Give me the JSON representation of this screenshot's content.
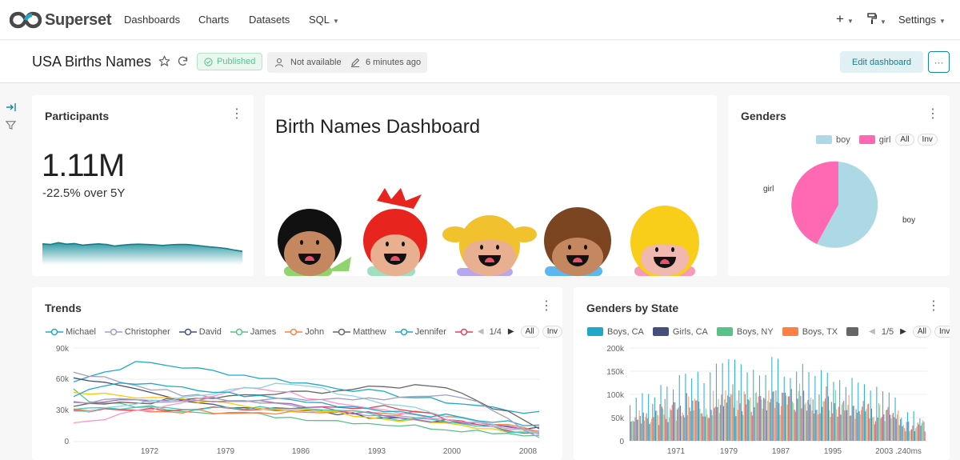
{
  "nav": {
    "brand": "Superset",
    "items": [
      "Dashboards",
      "Charts",
      "Datasets",
      "SQL"
    ],
    "settings": "Settings"
  },
  "header": {
    "title": "USA Births Names",
    "status": "Published",
    "owner": "Not available",
    "modified": "6 minutes ago",
    "edit_label": "Edit dashboard",
    "more_label": "···"
  },
  "participants": {
    "title": "Participants",
    "value": "1.11M",
    "subtitle": "-22.5% over 5Y",
    "sparkline": [
      0.62,
      0.6,
      0.66,
      0.61,
      0.63,
      0.58,
      0.6,
      0.62,
      0.6,
      0.55,
      0.58,
      0.6,
      0.61,
      0.6,
      0.59,
      0.57,
      0.59,
      0.6,
      0.6,
      0.58,
      0.55,
      0.52,
      0.5,
      0.47,
      0.42,
      0.38
    ]
  },
  "markdown": {
    "title": "Birth Names Dashboard"
  },
  "genders": {
    "title": "Genders",
    "legend": [
      "boy",
      "girl"
    ],
    "all_label": "All",
    "inv_label": "Inv",
    "slice_labels": {
      "girl": "girl",
      "boy": "boy"
    },
    "colors": {
      "boy": "#add8e6",
      "girl": "#ff69b4"
    }
  },
  "trends": {
    "title": "Trends",
    "legend": [
      "Michael",
      "Christopher",
      "David",
      "James",
      "John",
      "Matthew",
      "Jennifer"
    ],
    "legend_colors": [
      "#1fa8c9",
      "#a0a0c0",
      "#454e7c",
      "#5ac189",
      "#ff7f44",
      "#666666",
      "#1fa8c9",
      "#e04355"
    ],
    "page": "1/4",
    "all_label": "All",
    "inv_label": "Inv",
    "y_ticks": [
      "90k",
      "60k",
      "30k",
      "0"
    ],
    "x_ticks": [
      "1972",
      "1979",
      "1986",
      "1993",
      "2000",
      "2008"
    ]
  },
  "genders_by_state": {
    "title": "Genders by State",
    "legend": [
      "Boys, CA",
      "Girls, CA",
      "Boys, NY",
      "Boys, TX"
    ],
    "legend_colors": [
      "#1fa8c9",
      "#454e7c",
      "#5ac189",
      "#ff7f44",
      "#666666"
    ],
    "page": "1/5",
    "all_label": "All",
    "inv_label": "Inv",
    "y_ticks": [
      "200k",
      "150k",
      "100k",
      "50k",
      "0"
    ],
    "x_ticks": [
      "1971",
      "1979",
      "1987",
      "1995",
      "2003 .240ms"
    ]
  }
}
